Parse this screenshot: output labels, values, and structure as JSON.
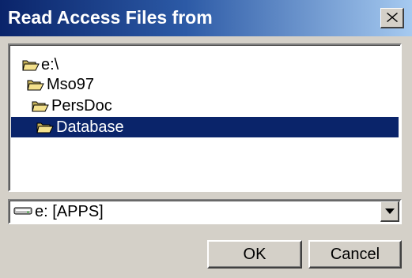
{
  "window": {
    "title": "Read Access Files from",
    "close_icon": "close-icon"
  },
  "folders": [
    {
      "label": "e:\\",
      "icon": "open-folder-icon",
      "selected": false
    },
    {
      "label": "Mso97",
      "icon": "open-folder-icon",
      "selected": false
    },
    {
      "label": "PersDoc",
      "icon": "open-folder-icon",
      "selected": false
    },
    {
      "label": "Database",
      "icon": "open-folder-icon",
      "selected": true
    }
  ],
  "drive": {
    "value": "e: [APPS]",
    "icon": "drive-icon"
  },
  "buttons": {
    "ok": "OK",
    "cancel": "Cancel"
  },
  "colors": {
    "title_bar": "#0a246a",
    "selection": "#0a246a",
    "dialog_face": "#d4d0c8",
    "folder": "#f4e18c"
  }
}
